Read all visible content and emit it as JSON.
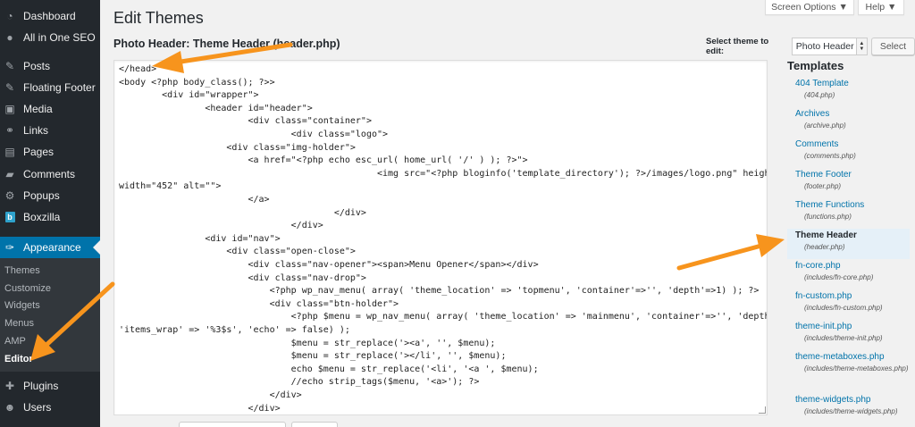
{
  "sidebar": {
    "items": [
      {
        "label": "Dashboard",
        "icon": "dashboard-icon",
        "glyph": "◔"
      },
      {
        "label": "All in One SEO",
        "icon": "seo-icon",
        "glyph": "●"
      },
      {
        "label": "Posts",
        "icon": "pushpin-icon",
        "glyph": "✎"
      },
      {
        "label": "Floating Footer",
        "icon": "pushpin-icon",
        "glyph": "✎"
      },
      {
        "label": "Media",
        "icon": "media-icon",
        "glyph": "▣"
      },
      {
        "label": "Links",
        "icon": "link-icon",
        "glyph": "⚭"
      },
      {
        "label": "Pages",
        "icon": "pages-icon",
        "glyph": "▤"
      },
      {
        "label": "Comments",
        "icon": "comment-icon",
        "glyph": "▰"
      },
      {
        "label": "Popups",
        "icon": "popup-icon",
        "glyph": "⚙"
      },
      {
        "label": "Boxzilla",
        "icon": "boxzilla-icon",
        "glyph": "b"
      },
      {
        "label": "Appearance",
        "icon": "paintbrush-icon",
        "glyph": "✑"
      }
    ],
    "submenu": [
      "Themes",
      "Customize",
      "Widgets",
      "Menus",
      "AMP",
      "Editor"
    ],
    "after": [
      {
        "label": "Plugins",
        "icon": "plugin-icon",
        "glyph": "✚"
      },
      {
        "label": "Users",
        "icon": "users-icon",
        "glyph": "☻"
      }
    ]
  },
  "screen_meta": {
    "screen_options": "Screen Options ▼",
    "help": "Help ▼"
  },
  "page_title": "Edit Themes",
  "file_heading": "Photo Header: Theme Header (header.php)",
  "theme_select": {
    "label": "Select theme to edit:",
    "value": "Photo Header",
    "button": "Select"
  },
  "code_lines": [
    "</head>",
    "<body <?php body_class(); ?>>",
    "        <div id=\"wrapper\">",
    "                <header id=\"header\">",
    "                        <div class=\"container\">",
    "                                <div class=\"logo\">",
    "                    <div class=\"img-holder\">",
    "                        <a href=\"<?php echo esc_url( home_url( '/' ) ); ?>\">",
    "                                                <img src=\"<?php bloginfo('template_directory'); ?>/images/logo.png\" height=\"70\"",
    "width=\"452\" alt=\"\">",
    "                        </a>",
    "                                        </div>",
    "                                </div>",
    "                <div id=\"nav\">",
    "                    <div class=\"open-close\">",
    "                        <div class=\"nav-opener\"><span>Menu Opener</span></div>",
    "                        <div class=\"nav-drop\">",
    "                            <?php wp_nav_menu( array( 'theme_location' => 'topmenu', 'container'=>'', 'depth'=>1) ); ?>",
    "                            <div class=\"btn-holder\">",
    "                                <?php $menu = wp_nav_menu( array( 'theme_location' => 'mainmenu', 'container'=>'', 'depth'=>1,",
    "'items_wrap' => '%3$s', 'echo' => false) );",
    "                                $menu = str_replace('><a', '', $menu);",
    "                                $menu = str_replace('></li', '', $menu);",
    "                                echo $menu = str_replace('<li', '<a ', $menu);",
    "                                //echo strip_tags($menu, '<a>'); ?>",
    "                            </div>",
    "                        </div>",
    "                                </div>",
    "                        </div>"
  ],
  "templates": {
    "title": "Templates",
    "items": [
      {
        "name": "404 Template",
        "file": "(404.php)"
      },
      {
        "name": "Archives",
        "file": "(archive.php)"
      },
      {
        "name": "Comments",
        "file": "(comments.php)"
      },
      {
        "name": "Theme Footer",
        "file": "(footer.php)"
      },
      {
        "name": "Theme Functions",
        "file": "(functions.php)"
      },
      {
        "name": "Theme Header",
        "file": "(header.php)",
        "current": true
      },
      {
        "name": "fn-core.php",
        "file": "(includes/fn-core.php)"
      },
      {
        "name": "fn-custom.php",
        "file": "(includes/fn-custom.php)"
      },
      {
        "name": "theme-init.php",
        "file": "(includes/theme-init.php)"
      },
      {
        "name": "theme-metaboxes.php",
        "file": "(includes/theme-metaboxes.php)"
      },
      {
        "name": "theme-widgets.php",
        "file": "(includes/theme-widgets.php)"
      }
    ]
  },
  "colors": {
    "sidebar_bg": "#23282d",
    "accent": "#0073aa",
    "arrow": "#f7941d"
  }
}
